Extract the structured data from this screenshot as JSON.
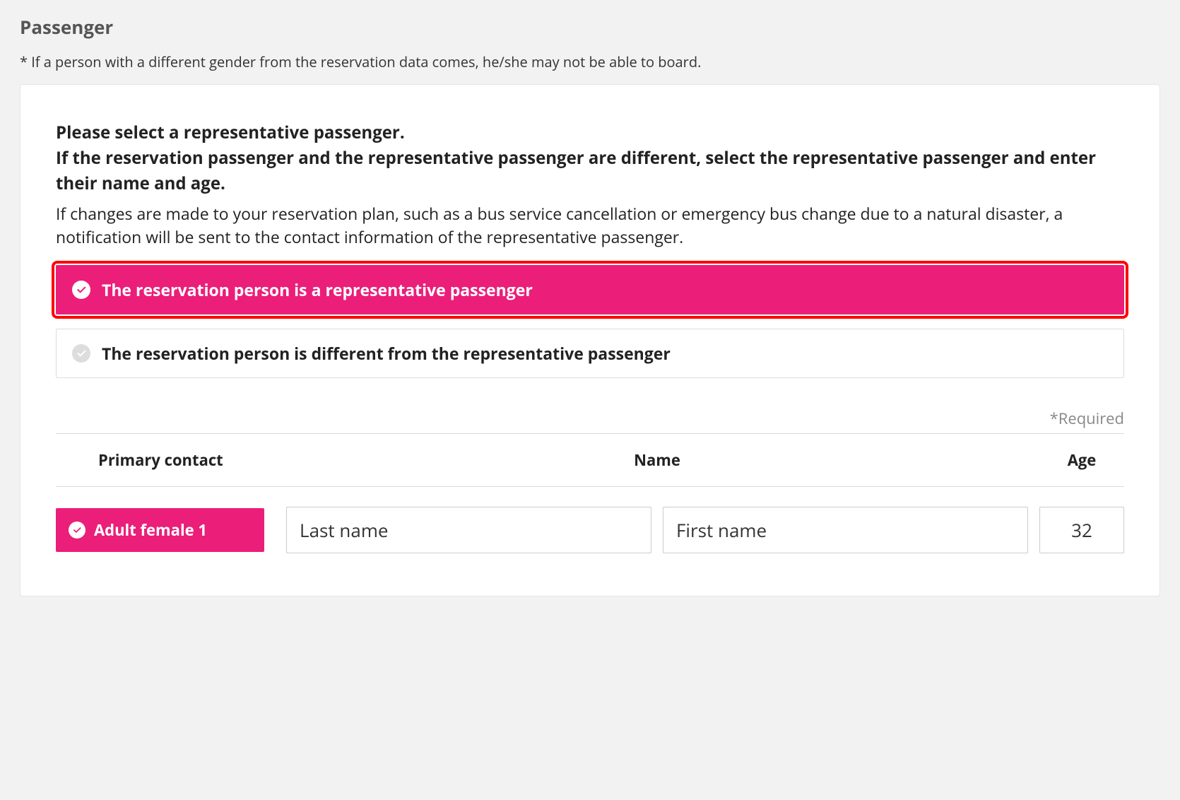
{
  "page_title": "Passenger",
  "gender_note": "* If a person with a different gender from the reservation data comes, he/she may not be able to board.",
  "instructions_bold_line1": "Please select a representative passenger.",
  "instructions_bold_line2": "If the reservation passenger and the representative passenger are different, select the representative passenger and enter their name and age.",
  "instructions_normal": "If changes are made to your reservation plan, such as a bus service cancellation or emergency bus change due to a natural disaster, a notification will be sent to the contact information of the representative passenger.",
  "options": {
    "same": "The reservation person is a representative passenger",
    "different": "The reservation person is different from the representative passenger"
  },
  "required_label": "*Required",
  "table": {
    "col_contact": "Primary contact",
    "col_name": "Name",
    "col_age": "Age"
  },
  "passenger": {
    "contact_label": "Adult female 1",
    "last_name_placeholder": "Last name",
    "first_name_placeholder": "First name",
    "age_value": "32"
  }
}
